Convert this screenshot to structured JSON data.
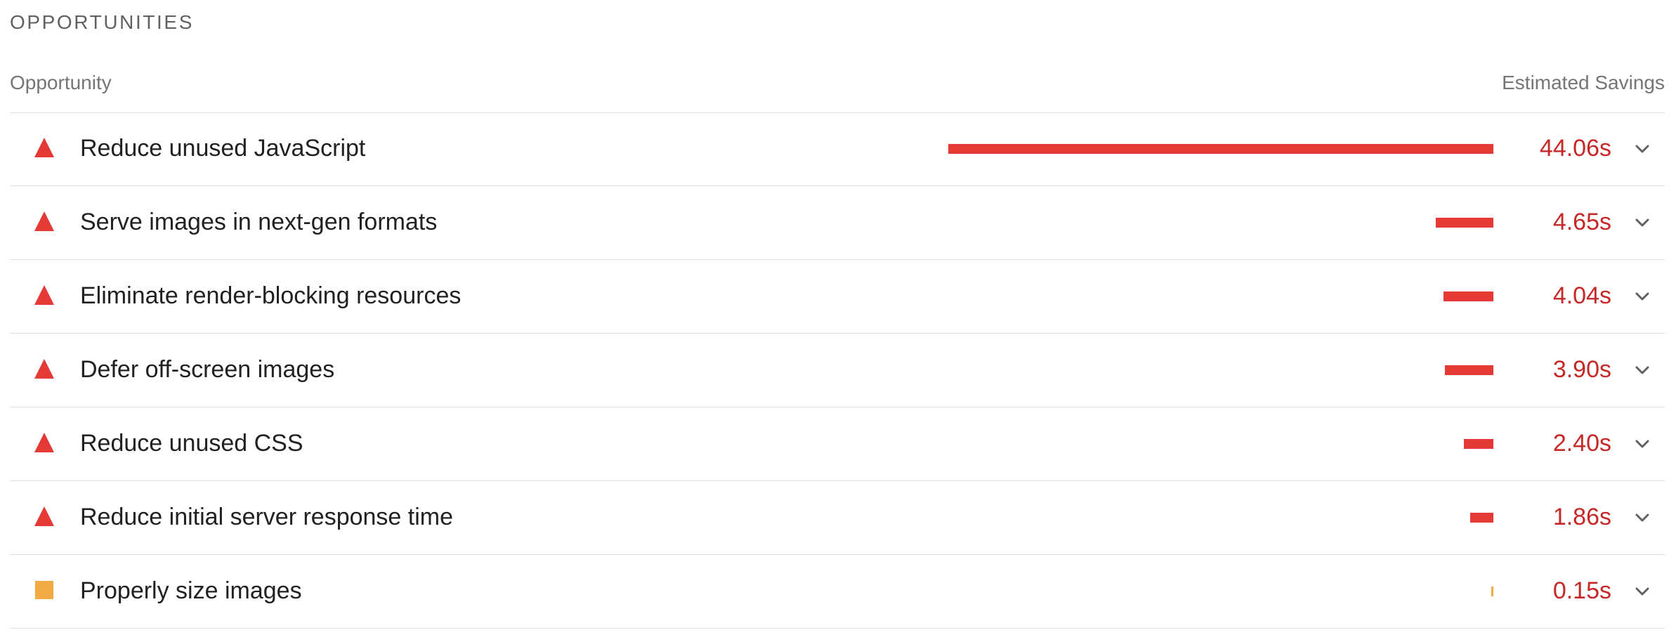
{
  "section": {
    "title": "OPPORTUNITIES"
  },
  "table": {
    "column_opportunity": "Opportunity",
    "column_savings": "Estimated Savings"
  },
  "colors": {
    "fail": "#e53935",
    "average": "#f2ab42",
    "value_text": "#c62828"
  },
  "items": [
    {
      "label": "Reduce unused JavaScript",
      "value": "44.06s",
      "savings_seconds": 44.06,
      "status": "fail",
      "icon": "warning-triangle-icon"
    },
    {
      "label": "Serve images in next-gen formats",
      "value": "4.65s",
      "savings_seconds": 4.65,
      "status": "fail",
      "icon": "warning-triangle-icon"
    },
    {
      "label": "Eliminate render-blocking resources",
      "value": "4.04s",
      "savings_seconds": 4.04,
      "status": "fail",
      "icon": "warning-triangle-icon"
    },
    {
      "label": "Defer off-screen images",
      "value": "3.90s",
      "savings_seconds": 3.9,
      "status": "fail",
      "icon": "warning-triangle-icon"
    },
    {
      "label": "Reduce unused CSS",
      "value": "2.40s",
      "savings_seconds": 2.4,
      "status": "fail",
      "icon": "warning-triangle-icon"
    },
    {
      "label": "Reduce initial server response time",
      "value": "1.86s",
      "savings_seconds": 1.86,
      "status": "fail",
      "icon": "warning-triangle-icon"
    },
    {
      "label": "Properly size images",
      "value": "0.15s",
      "savings_seconds": 0.15,
      "status": "average",
      "icon": "average-square-icon"
    }
  ]
}
